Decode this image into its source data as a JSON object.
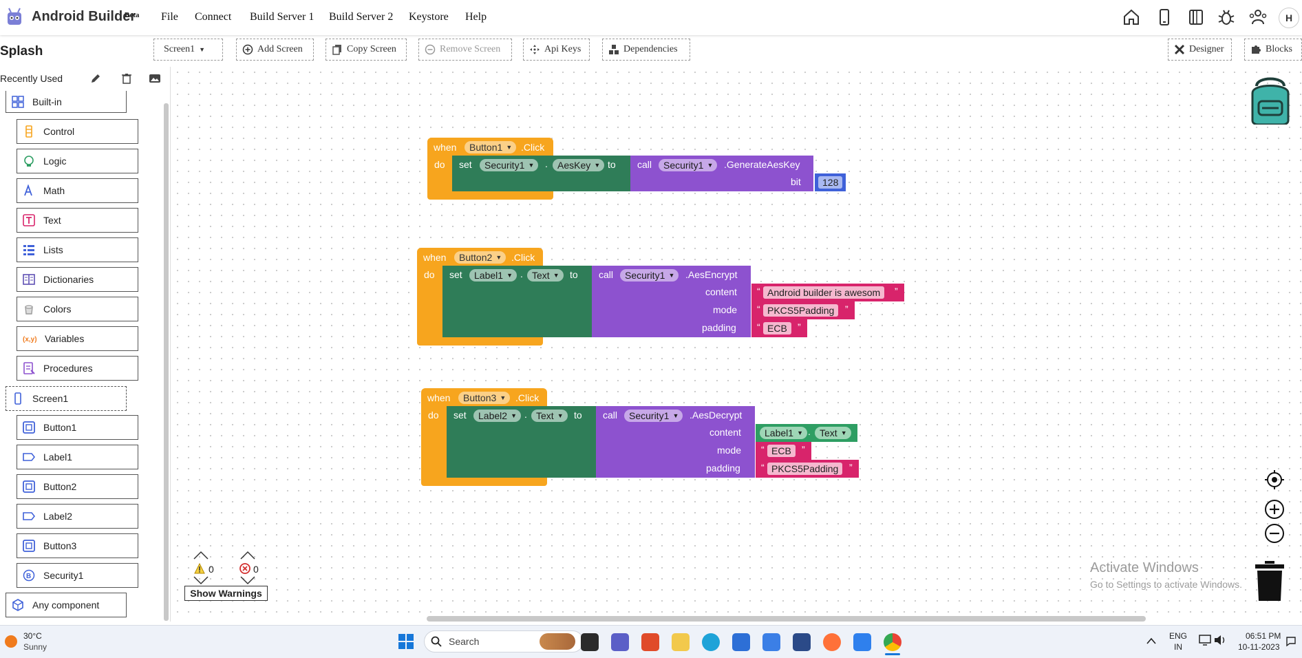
{
  "app": {
    "title": "Android Builder",
    "beta": "Beta",
    "menu": [
      "File",
      "Connect",
      "Build Server 1",
      "Build Server 2",
      "Keystore",
      "Help"
    ],
    "avatar": "H",
    "top_icons": [
      "home-icon",
      "phone-icon",
      "book-icon",
      "bug-icon",
      "users-icon"
    ]
  },
  "toolbar": {
    "page_title": "Splash",
    "screen_select": "Screen1",
    "add_screen": "Add Screen",
    "copy_screen": "Copy Screen",
    "remove_screen": "Remove Screen",
    "api_keys": "Api Keys",
    "dependencies": "Dependencies",
    "designer": "Designer",
    "blocks": "Blocks"
  },
  "sidebar": {
    "recent_label": "Recently Used",
    "builtin": "Built-in",
    "builtin_items": [
      {
        "label": "Control",
        "color": "#f7a51e"
      },
      {
        "label": "Logic",
        "color": "#2e9e63"
      },
      {
        "label": "Math",
        "color": "#3f61d9"
      },
      {
        "label": "Text",
        "color": "#d8246b"
      },
      {
        "label": "Lists",
        "color": "#3f61d9"
      },
      {
        "label": "Dictionaries",
        "color": "#5e4fb3"
      },
      {
        "label": "Colors",
        "color": "#9a9a9a"
      },
      {
        "label": "Variables",
        "color": "#f07b1d"
      },
      {
        "label": "Procedures",
        "color": "#8d52cf"
      }
    ],
    "screen": "Screen1",
    "components": [
      "Button1",
      "Label1",
      "Button2",
      "Label2",
      "Button3",
      "Security1"
    ],
    "any_component": "Any component"
  },
  "blocks": {
    "block1": {
      "when": "when",
      "component": "Button1",
      "event": ".Click",
      "do": "do",
      "set": "set",
      "set_component": "Security1",
      "property": "AesKey",
      "to": "to",
      "call": "call",
      "call_component": "Security1",
      "method": ".GenerateAesKey",
      "arg_label": "bit",
      "arg_value": "128"
    },
    "block2": {
      "when": "when",
      "component": "Button2",
      "event": ".Click",
      "do": "do",
      "set": "set",
      "set_component": "Label1",
      "property": "Text",
      "to": "to",
      "call": "call",
      "call_component": "Security1",
      "method": ".AesEncrypt",
      "content_label": "content",
      "content_value": "Android builder is awesom",
      "mode_label": "mode",
      "mode_value": "PKCS5Padding",
      "padding_label": "padding",
      "padding_value": "ECB"
    },
    "block3": {
      "when": "when",
      "component": "Button3",
      "event": ".Click",
      "do": "do",
      "set": "set",
      "set_component": "Label2",
      "property": "Text",
      "to": "to",
      "call": "call",
      "call_component": "Security1",
      "method": ".AesDecrypt",
      "content_label": "content",
      "content_component": "Label1",
      "content_property": "Text",
      "mode_label": "mode",
      "mode_value": "ECB",
      "padding_label": "padding",
      "padding_value": "PKCS5Padding"
    },
    "quote_open": "“",
    "quote_close": "”"
  },
  "warnings": {
    "warning_count": "0",
    "error_count": "0",
    "show_warnings": "Show Warnings"
  },
  "watermark": {
    "line1": "Activate Windows",
    "line2": "Go to Settings to activate Windows."
  },
  "taskbar": {
    "temperature": "30°C",
    "weather": "Sunny",
    "search_placeholder": "Search",
    "lang1": "ENG",
    "lang2": "IN",
    "time": "06:51 PM",
    "date": "10-11-2023"
  }
}
